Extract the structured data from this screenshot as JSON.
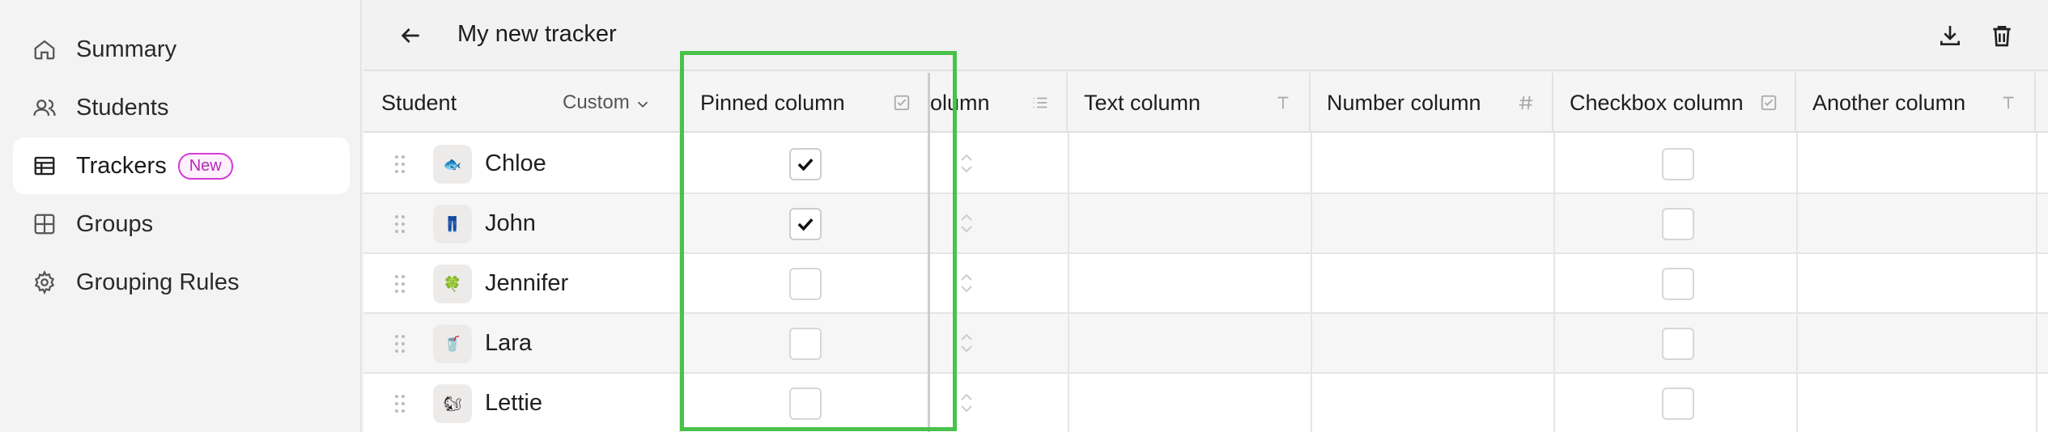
{
  "sidebar": {
    "items": [
      {
        "label": "Summary",
        "icon": "home-icon"
      },
      {
        "label": "Students",
        "icon": "users-icon"
      },
      {
        "label": "Trackers",
        "icon": "table-icon",
        "badge": "New",
        "active": true
      },
      {
        "label": "Groups",
        "icon": "grid-icon"
      },
      {
        "label": "Grouping Rules",
        "icon": "gear-icon"
      }
    ]
  },
  "header": {
    "title": "My new tracker",
    "back_icon": "arrow-left-icon",
    "actions": [
      "download-icon",
      "trash-icon"
    ]
  },
  "table": {
    "student_header": "Student",
    "sort_label": "Custom",
    "columns": [
      {
        "label": "Pinned column",
        "icon": "checkbox-icon"
      },
      {
        "label": "olumn",
        "icon": "list-icon"
      },
      {
        "label": "Text column",
        "icon": "text-icon"
      },
      {
        "label": "Number column",
        "icon": "hash-icon"
      },
      {
        "label": "Checkbox column",
        "icon": "checkbox-icon"
      },
      {
        "label": "Another column",
        "icon": "text-icon"
      }
    ],
    "rows": [
      {
        "name": "Chloe",
        "avatar": "🐟",
        "pinned_checked": true
      },
      {
        "name": "John",
        "avatar": "👖",
        "pinned_checked": true
      },
      {
        "name": "Jennifer",
        "avatar": "🍀",
        "pinned_checked": false
      },
      {
        "name": "Lara",
        "avatar": "🥤",
        "pinned_checked": false
      },
      {
        "name": "Lettie",
        "avatar": "🐿",
        "pinned_checked": false
      }
    ]
  },
  "colors": {
    "highlight": "#48c24a",
    "badge": "#d63bd6"
  }
}
